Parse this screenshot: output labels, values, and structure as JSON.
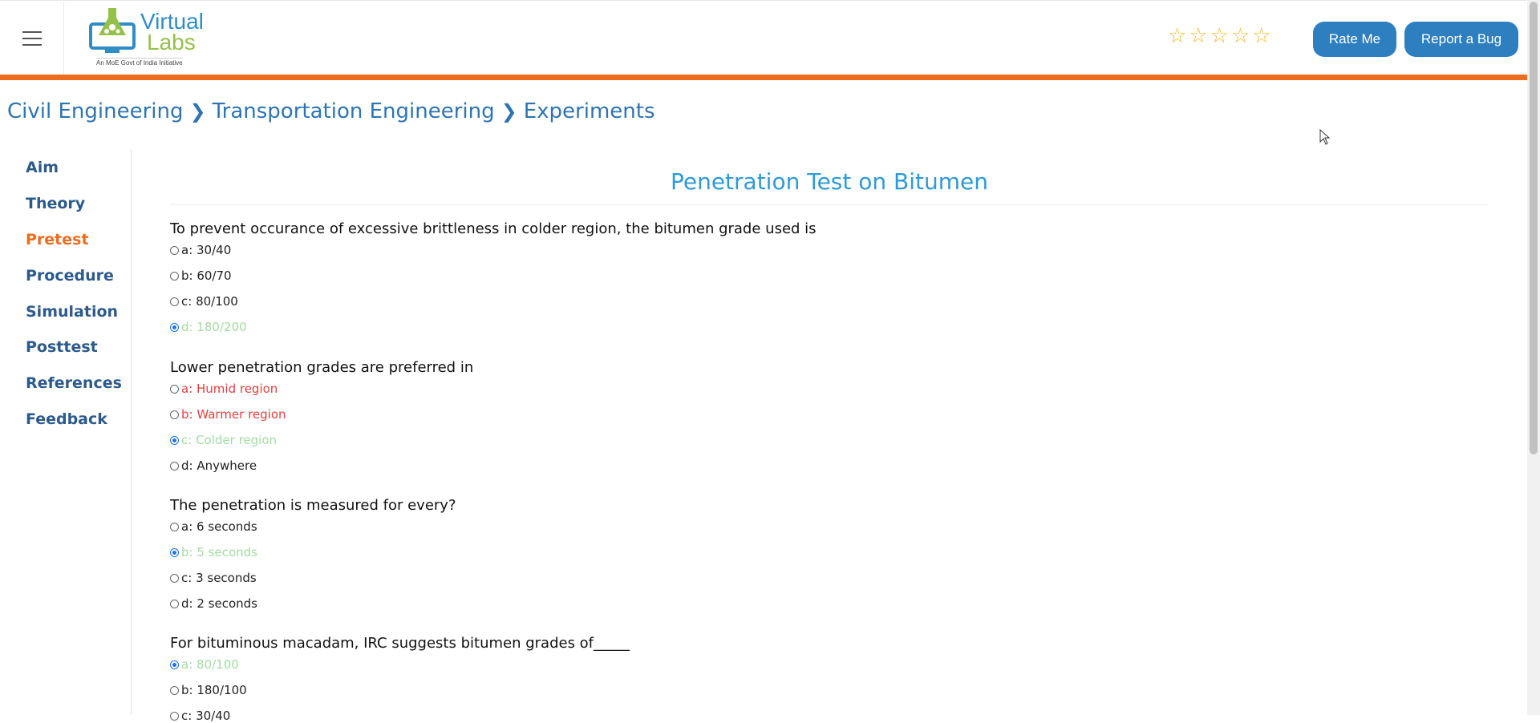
{
  "header": {
    "logo_line1": "Virtual",
    "logo_line2": "Labs",
    "logo_subtitle": "An MoE Govt of India Initiative",
    "rating_stars": 5,
    "rate_button": "Rate Me",
    "bug_button": "Report a Bug"
  },
  "breadcrumb": [
    "Civil Engineering",
    "Transportation Engineering",
    "Experiments"
  ],
  "sidebar": {
    "items": [
      {
        "label": "Aim"
      },
      {
        "label": "Theory"
      },
      {
        "label": "Pretest"
      },
      {
        "label": "Procedure"
      },
      {
        "label": "Simulation"
      },
      {
        "label": "Posttest"
      },
      {
        "label": "References"
      },
      {
        "label": "Feedback"
      }
    ],
    "active": "Pretest"
  },
  "main": {
    "title": "Penetration Test on Bitumen",
    "questions": [
      {
        "text": "To prevent occurance of excessive brittleness in colder region, the bitumen grade used is",
        "options": [
          {
            "label": "a: 30/40",
            "state": "normal",
            "checked": false
          },
          {
            "label": "b: 60/70",
            "state": "normal",
            "checked": false
          },
          {
            "label": "c: 80/100",
            "state": "normal",
            "checked": false
          },
          {
            "label": "d: 180/200",
            "state": "correct",
            "checked": true
          }
        ]
      },
      {
        "text": "Lower penetration grades are preferred in",
        "options": [
          {
            "label": "a: Humid region",
            "state": "wrong",
            "checked": false
          },
          {
            "label": "b: Warmer region",
            "state": "wrong",
            "checked": false
          },
          {
            "label": "c: Colder region",
            "state": "correct",
            "checked": true
          },
          {
            "label": "d: Anywhere",
            "state": "normal",
            "checked": false
          }
        ]
      },
      {
        "text": "The penetration is measured for every?",
        "options": [
          {
            "label": "a: 6 seconds",
            "state": "normal",
            "checked": false
          },
          {
            "label": "b: 5 seconds",
            "state": "correct",
            "checked": true
          },
          {
            "label": "c: 3 seconds",
            "state": "normal",
            "checked": false
          },
          {
            "label": "d: 2 seconds",
            "state": "normal",
            "checked": false
          }
        ]
      },
      {
        "text": "For bituminous macadam, IRC suggests bitumen grades of_____",
        "options": [
          {
            "label": "a: 80/100",
            "state": "correct",
            "checked": true
          },
          {
            "label": "b: 180/100",
            "state": "normal",
            "checked": false
          },
          {
            "label": "c: 30/40",
            "state": "normal",
            "checked": false
          }
        ]
      }
    ]
  },
  "colors": {
    "accent_orange": "#ed6c1f",
    "button_blue": "#2d7fc0",
    "title_blue": "#2e9ad6",
    "correct_green": "#a3dba3",
    "wrong_red": "#e0413f"
  }
}
